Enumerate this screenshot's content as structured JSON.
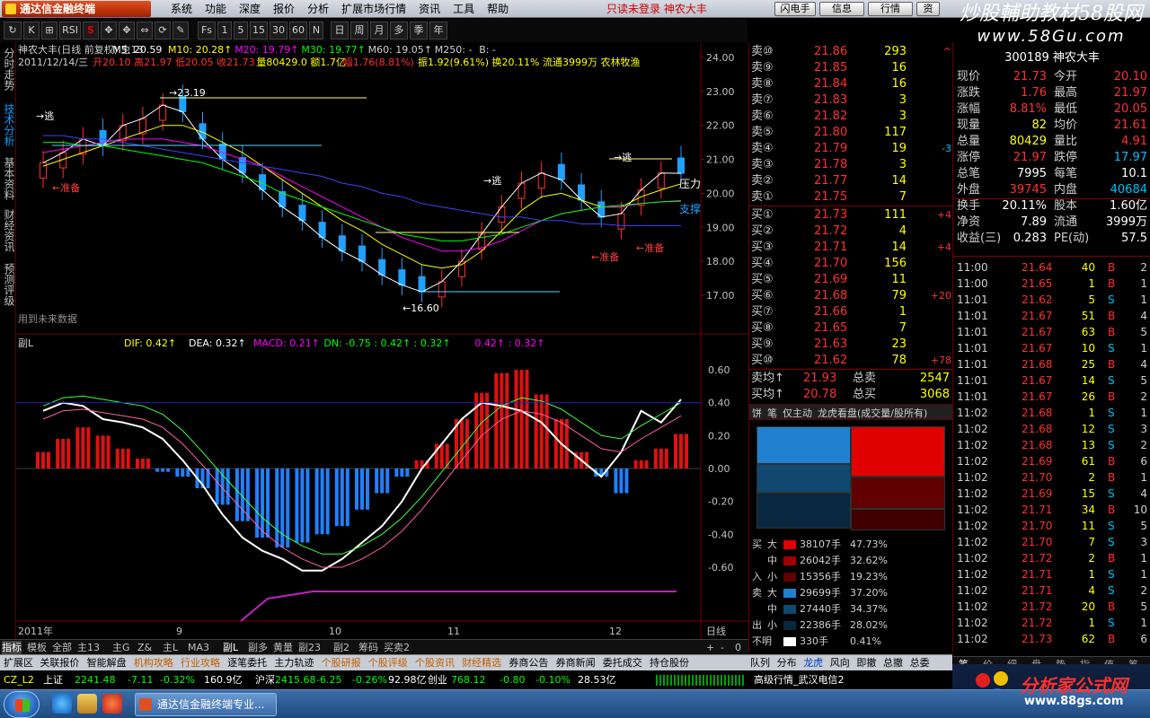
{
  "app": {
    "logo_text": "通达信金融终端",
    "menu": [
      "系统",
      "功能",
      "深度",
      "报价",
      "分析",
      "扩展市场行情",
      "资讯",
      "工具",
      "帮助"
    ],
    "promo": "只读未登录  神农大丰",
    "top_buttons": [
      "闪电手",
      "信息",
      "行情",
      "资"
    ],
    "watermark_title": "炒股輔助教材58股网",
    "watermark_url": "www.58Gu.com"
  },
  "toolbar": {
    "buttons": [
      "↻",
      "K",
      "⊞",
      "RSI",
      "S",
      "✥",
      "✥",
      "⇔",
      "⟳",
      "✎",
      "Fs",
      "1",
      "5",
      "15",
      "30",
      "60",
      "N",
      "日",
      "周",
      "月",
      "多",
      "季",
      "年"
    ]
  },
  "left_tabs": [
    {
      "label": "分时走势",
      "active": false
    },
    {
      "label": "技术分析",
      "active": true
    },
    {
      "label": "基本资料",
      "active": false
    },
    {
      "label": "财经资讯",
      "active": false
    },
    {
      "label": "预测评级",
      "active": false
    }
  ],
  "main_header": {
    "line1": [
      {
        "text": "神农大丰(日线 前复权) 主13",
        "color": "#d0d0d0"
      },
      {
        "text": "M5: 20.59",
        "color": "#ffffff"
      },
      {
        "text": "M10: 20.28↑",
        "color": "#ffff00"
      },
      {
        "text": "M20: 19.79↑",
        "color": "#ff00ff"
      },
      {
        "text": "M30: 19.77↑",
        "color": "#00ff00"
      },
      {
        "text": "M60: 19.05↑",
        "color": "#d0d0d0"
      },
      {
        "text": "M250: -",
        "color": "#d0d0d0"
      },
      {
        "text": "B: -",
        "color": "#d0d0d0"
      }
    ],
    "line2": [
      {
        "text": "2011/12/14/三",
        "color": "#d0d0d0"
      },
      {
        "text": "开20.10 高21.97 低20.05 收21.73",
        "color": "#ff3030"
      },
      {
        "text": "量80429.0 额1.7亿",
        "color": "#ffff00"
      },
      {
        "text": "幅1.76(8.81%)",
        "color": "#ff3030"
      },
      {
        "text": "振1.92(9.61%) 换20.11% 流通3999万 农林牧渔",
        "color": "#ffff00"
      }
    ],
    "price_axis": [
      "24.00",
      "23.00",
      "22.00",
      "21.00",
      "20.00",
      "19.00",
      "18.00",
      "17.00"
    ],
    "annotations": {
      "high_label": "23.19",
      "low_label": "16.60",
      "pressure": "压力",
      "support": "支撑",
      "escape": "逃",
      "prepare": "准备",
      "footnote": "用到未来数据"
    }
  },
  "sub_header": {
    "title": "副L",
    "items": [
      {
        "text": "DIF: 0.42↑",
        "color": "#ffff00"
      },
      {
        "text": "DEA: 0.32↑",
        "color": "#ffffff"
      },
      {
        "text": "MACD: 0.21↑",
        "color": "#ff00ff"
      },
      {
        "text": "DN: -0.75 : 0.42↑ : 0.32↑",
        "color": "#00ff00"
      },
      {
        "text": "0.42↑ : 0.32↑",
        "color": "#ff00ff"
      }
    ],
    "value_axis": [
      "0.60",
      "0.40",
      "0.20",
      "0.00",
      "-0.20",
      "-0.40",
      "-0.60"
    ]
  },
  "chart_data": {
    "type": "line",
    "title": "神农大丰(日线 前复权)",
    "xlabel": "",
    "ylabel": "",
    "x_ticks": [
      "2011年",
      "9",
      "10",
      "11",
      "12"
    ],
    "ylim": [
      16.4,
      24.3
    ],
    "series": [
      {
        "name": "M5",
        "values": [
          20.9,
          21.2,
          21.6,
          21.4,
          22.0,
          22.2,
          22.6,
          22.4,
          21.6,
          21.0,
          20.6,
          20.1,
          19.6,
          19.2,
          18.7,
          18.3,
          18.0,
          17.6,
          17.3,
          17.1,
          17.4,
          18.0,
          18.8,
          19.6,
          20.3,
          20.6,
          20.4,
          19.8,
          19.3,
          19.4,
          20.1,
          20.6,
          20.59
        ]
      },
      {
        "name": "M10",
        "values": [
          20.8,
          21.0,
          21.2,
          21.4,
          21.6,
          21.8,
          22.0,
          22.0,
          21.8,
          21.5,
          21.2,
          20.8,
          20.4,
          20.0,
          19.6,
          19.2,
          18.9,
          18.5,
          18.2,
          17.9,
          17.8,
          17.9,
          18.3,
          18.9,
          19.5,
          19.9,
          20.0,
          19.8,
          19.6,
          19.6,
          19.9,
          20.1,
          20.28
        ]
      },
      {
        "name": "M20",
        "values": [
          21.2,
          21.3,
          21.4,
          21.5,
          21.6,
          21.6,
          21.6,
          21.5,
          21.4,
          21.2,
          21.0,
          20.8,
          20.5,
          20.2,
          19.9,
          19.6,
          19.3,
          19.0,
          18.7,
          18.5,
          18.3,
          18.3,
          18.4,
          18.6,
          18.9,
          19.2,
          19.4,
          19.5,
          19.6,
          19.6,
          19.7,
          19.75,
          19.79
        ]
      },
      {
        "name": "M30",
        "values": [
          21.5,
          21.5,
          21.4,
          21.4,
          21.3,
          21.2,
          21.1,
          21.0,
          20.9,
          20.7,
          20.5,
          20.3,
          20.0,
          19.8,
          19.6,
          19.4,
          19.2,
          19.0,
          18.8,
          18.7,
          18.6,
          18.6,
          18.7,
          18.8,
          19.0,
          19.2,
          19.4,
          19.5,
          19.6,
          19.65,
          19.7,
          19.75,
          19.77
        ]
      },
      {
        "name": "M60",
        "values": [
          21.7,
          21.7,
          21.6,
          21.6,
          21.5,
          21.4,
          21.3,
          21.2,
          21.1,
          21.0,
          20.9,
          20.8,
          20.7,
          20.6,
          20.5,
          20.3,
          20.2,
          20.0,
          19.9,
          19.7,
          19.6,
          19.5,
          19.4,
          19.3,
          19.3,
          19.2,
          19.2,
          19.1,
          19.1,
          19.05,
          19.05,
          19.05,
          19.05
        ]
      }
    ],
    "macd_bars": [
      0.1,
      0.18,
      0.25,
      0.2,
      0.12,
      0.06,
      -0.02,
      -0.05,
      -0.12,
      -0.22,
      -0.32,
      -0.42,
      -0.48,
      -0.45,
      -0.4,
      -0.35,
      -0.25,
      -0.15,
      -0.05,
      0.05,
      0.15,
      0.3,
      0.46,
      0.58,
      0.6,
      0.45,
      0.3,
      0.1,
      -0.05,
      -0.15,
      0.05,
      0.12,
      0.21
    ],
    "dif": [
      0.35,
      0.4,
      0.38,
      0.3,
      0.28,
      0.25,
      0.18,
      0.05,
      -0.1,
      -0.28,
      -0.42,
      -0.5,
      -0.55,
      -0.62,
      -0.62,
      -0.55,
      -0.45,
      -0.35,
      -0.2,
      0.0,
      0.15,
      0.3,
      0.4,
      0.38,
      0.35,
      0.28,
      0.15,
      0.05,
      -0.05,
      0.1,
      0.35,
      0.28,
      0.42
    ],
    "dea": [
      0.3,
      0.35,
      0.36,
      0.34,
      0.32,
      0.3,
      0.25,
      0.15,
      0.02,
      -0.12,
      -0.25,
      -0.38,
      -0.48,
      -0.55,
      -0.6,
      -0.6,
      -0.55,
      -0.48,
      -0.38,
      -0.25,
      -0.1,
      0.05,
      0.2,
      0.3,
      0.35,
      0.33,
      0.28,
      0.2,
      0.12,
      0.1,
      0.18,
      0.25,
      0.32
    ]
  },
  "order_book": {
    "sell": [
      {
        "label": "卖⑩",
        "price": "21.86",
        "vol": "293",
        "extra": "^"
      },
      {
        "label": "卖⑨",
        "price": "21.85",
        "vol": "16",
        "extra": ""
      },
      {
        "label": "卖⑧",
        "price": "21.84",
        "vol": "16",
        "extra": ""
      },
      {
        "label": "卖⑦",
        "price": "21.83",
        "vol": "3",
        "extra": ""
      },
      {
        "label": "卖⑥",
        "price": "21.82",
        "vol": "3",
        "extra": ""
      },
      {
        "label": "卖⑤",
        "price": "21.80",
        "vol": "117",
        "extra": ""
      },
      {
        "label": "卖④",
        "price": "21.79",
        "vol": "19",
        "extra": "-3"
      },
      {
        "label": "卖③",
        "price": "21.78",
        "vol": "3",
        "extra": ""
      },
      {
        "label": "卖②",
        "price": "21.77",
        "vol": "14",
        "extra": ""
      },
      {
        "label": "卖①",
        "price": "21.75",
        "vol": "7",
        "extra": ""
      }
    ],
    "buy": [
      {
        "label": "买①",
        "price": "21.73",
        "vol": "111",
        "extra": "+4"
      },
      {
        "label": "买②",
        "price": "21.72",
        "vol": "4",
        "extra": ""
      },
      {
        "label": "买③",
        "price": "21.71",
        "vol": "14",
        "extra": "+4"
      },
      {
        "label": "买④",
        "price": "21.70",
        "vol": "156",
        "extra": ""
      },
      {
        "label": "买⑤",
        "price": "21.69",
        "vol": "11",
        "extra": ""
      },
      {
        "label": "买⑥",
        "price": "21.68",
        "vol": "79",
        "extra": "+20"
      },
      {
        "label": "买⑦",
        "price": "21.66",
        "vol": "1",
        "extra": ""
      },
      {
        "label": "买⑧",
        "price": "21.65",
        "vol": "7",
        "extra": ""
      },
      {
        "label": "买⑨",
        "price": "21.63",
        "vol": "23",
        "extra": ""
      },
      {
        "label": "买⑩",
        "price": "21.62",
        "vol": "78",
        "extra": "+78"
      }
    ],
    "avg": [
      {
        "label": "卖均↑",
        "price": "21.93",
        "tlabel": "总卖",
        "tval": "2547"
      },
      {
        "label": "买均↑",
        "price": "20.78",
        "tlabel": "总买",
        "tval": "3068"
      }
    ],
    "tabs": [
      "饼",
      "笔",
      "仅主动",
      "龙虎看盘(成交量/股所有)"
    ],
    "flow": [
      {
        "side": "买",
        "size": "大",
        "color": "#e00000",
        "vol": "38107手",
        "pct": "47.73%"
      },
      {
        "side": "",
        "size": "中",
        "color": "#a00000",
        "vol": "26042手",
        "pct": "32.62%"
      },
      {
        "side": "入",
        "size": "小",
        "color": "#600000",
        "vol": "15356手",
        "pct": "19.23%"
      },
      {
        "side": "卖",
        "size": "大",
        "color": "#2080d0",
        "vol": "29699手",
        "pct": "37.20%"
      },
      {
        "side": "",
        "size": "中",
        "color": "#104870",
        "vol": "27440手",
        "pct": "34.37%"
      },
      {
        "side": "出",
        "size": "小",
        "color": "#082840",
        "vol": "22386手",
        "pct": "28.02%"
      },
      {
        "side": "不明",
        "size": "",
        "color": "#ffffff",
        "vol": "330手",
        "pct": "0.41%"
      }
    ]
  },
  "quote": {
    "code_name": "300189 神农大丰",
    "rows": [
      {
        "l1": "现价",
        "v1": "21.73",
        "c1": "#ff3030",
        "l2": "今开",
        "v2": "20.10",
        "c2": "#ff3030"
      },
      {
        "l1": "涨跌",
        "v1": "1.76",
        "c1": "#ff3030",
        "l2": "最高",
        "v2": "21.97",
        "c2": "#ff3030"
      },
      {
        "l1": "涨幅",
        "v1": "8.81%",
        "c1": "#ff3030",
        "l2": "最低",
        "v2": "20.05",
        "c2": "#ff3030"
      },
      {
        "l1": "现量",
        "v1": "82",
        "c1": "#ffff00",
        "l2": "均价",
        "v2": "21.61",
        "c2": "#ff3030"
      },
      {
        "l1": "总量",
        "v1": "80429",
        "c1": "#ffff00",
        "l2": "量比",
        "v2": "4.91",
        "c2": "#ff3030"
      },
      {
        "l1": "涨停",
        "v1": "21.97",
        "c1": "#ff3030",
        "l2": "跌停",
        "v2": "17.97",
        "c2": "#00c0ff"
      },
      {
        "l1": "总笔",
        "v1": "7995",
        "c1": "#ffffff",
        "l2": "每笔",
        "v2": "10.1",
        "c2": "#ffffff"
      },
      {
        "l1": "外盘",
        "v1": "39745",
        "c1": "#ff3030",
        "l2": "内盘",
        "v2": "40684",
        "c2": "#00c0ff"
      },
      {
        "l1": "换手",
        "v1": "20.11%",
        "c1": "#ffffff",
        "l2": "股本",
        "v2": "1.60亿",
        "c2": "#ffffff"
      },
      {
        "l1": "净资",
        "v1": "7.89",
        "c1": "#ffffff",
        "l2": "流通",
        "v2": "3999万",
        "c2": "#ffffff"
      },
      {
        "l1": "收益(三)",
        "v1": "0.283",
        "c1": "#ffffff",
        "l2": "PE(动)",
        "v2": "57.5",
        "c2": "#ffffff"
      }
    ],
    "ticks": [
      {
        "t": "11:00",
        "p": "21.64",
        "v": "40",
        "d": "B",
        "n": "2"
      },
      {
        "t": "11:00",
        "p": "21.65",
        "v": "1",
        "d": "B",
        "n": "1"
      },
      {
        "t": "11:01",
        "p": "21.62",
        "v": "5",
        "d": "S",
        "n": "1"
      },
      {
        "t": "11:01",
        "p": "21.67",
        "v": "51",
        "d": "B",
        "n": "4"
      },
      {
        "t": "11:01",
        "p": "21.67",
        "v": "63",
        "d": "B",
        "n": "5"
      },
      {
        "t": "11:01",
        "p": "21.67",
        "v": "10",
        "d": "S",
        "n": "1"
      },
      {
        "t": "11:01",
        "p": "21.68",
        "v": "25",
        "d": "B",
        "n": "4"
      },
      {
        "t": "11:01",
        "p": "21.67",
        "v": "14",
        "d": "S",
        "n": "5"
      },
      {
        "t": "11:01",
        "p": "21.67",
        "v": "26",
        "d": "B",
        "n": "2"
      },
      {
        "t": "11:02",
        "p": "21.68",
        "v": "1",
        "d": "S",
        "n": "1"
      },
      {
        "t": "11:02",
        "p": "21.68",
        "v": "12",
        "d": "S",
        "n": "3"
      },
      {
        "t": "11:02",
        "p": "21.68",
        "v": "13",
        "d": "S",
        "n": "2"
      },
      {
        "t": "11:02",
        "p": "21.69",
        "v": "61",
        "d": "B",
        "n": "6"
      },
      {
        "t": "11:02",
        "p": "21.70",
        "v": "2",
        "d": "B",
        "n": "1"
      },
      {
        "t": "11:02",
        "p": "21.69",
        "v": "15",
        "d": "S",
        "n": "4"
      },
      {
        "t": "11:02",
        "p": "21.71",
        "v": "34",
        "d": "B",
        "n": "10"
      },
      {
        "t": "11:02",
        "p": "21.70",
        "v": "11",
        "d": "S",
        "n": "5"
      },
      {
        "t": "11:02",
        "p": "21.70",
        "v": "7",
        "d": "S",
        "n": "3"
      },
      {
        "t": "11:02",
        "p": "21.72",
        "v": "2",
        "d": "B",
        "n": "1"
      },
      {
        "t": "11:02",
        "p": "21.71",
        "v": "1",
        "d": "S",
        "n": "1"
      },
      {
        "t": "11:02",
        "p": "21.71",
        "v": "4",
        "d": "S",
        "n": "2"
      },
      {
        "t": "11:02",
        "p": "21.72",
        "v": "20",
        "d": "B",
        "n": "5"
      },
      {
        "t": "11:02",
        "p": "21.72",
        "v": "1",
        "d": "S",
        "n": "1"
      },
      {
        "t": "11:02",
        "p": "21.73",
        "v": "62",
        "d": "B",
        "n": "6"
      }
    ],
    "bottom_tabs": [
      "笔",
      "价",
      "细",
      "盘",
      "势",
      "指",
      "值",
      "筹"
    ]
  },
  "bottom_tabs": [
    "指标",
    "模板",
    "全部",
    "主13",
    "主G",
    "Z&",
    "主L",
    "MA3",
    "副L",
    "副多",
    "黄量",
    "副23",
    "副2",
    "筹码",
    "买卖2"
  ],
  "zoom_controls": {
    "label": "日线",
    "plus": "+",
    "minus": "-",
    "zero": "0"
  },
  "bottom_bar": {
    "left": [
      "扩展区",
      "关联报价",
      "智能解盘",
      "机构攻略",
      "行业攻略",
      "逐笔委托",
      "主力轨迹",
      "个股研报",
      "个股评级",
      "个股资讯",
      "财经精选",
      "券商公告",
      "券商新闻",
      "委托成交",
      "持仓股份"
    ],
    "right": [
      "队列",
      "分布",
      "龙虎",
      "风向",
      "即撤",
      "总撤",
      "总委"
    ]
  },
  "status": {
    "items": [
      {
        "text": "CZ_L2",
        "color": "#ffff00"
      },
      {
        "text": "上证",
        "color": "#ffffff"
      },
      {
        "text": "2241.48",
        "color": "#00ff00"
      },
      {
        "text": "-7.11",
        "color": "#00ff00"
      },
      {
        "text": "-0.32%",
        "color": "#00ff00"
      },
      {
        "text": "160.9亿",
        "color": "#ffffff"
      },
      {
        "text": "沪深",
        "color": "#ffffff"
      },
      {
        "text": "2415.68",
        "color": "#00ff00"
      },
      {
        "text": "-6.25",
        "color": "#00ff00"
      },
      {
        "text": "-0.26%",
        "color": "#00ff00"
      },
      {
        "text": "92.98亿",
        "color": "#ffffff"
      },
      {
        "text": "创业",
        "color": "#ffffff"
      },
      {
        "text": "768.12",
        "color": "#00ff00"
      },
      {
        "text": "-0.80",
        "color": "#00ff00"
      },
      {
        "text": "-0.10%",
        "color": "#00ff00"
      },
      {
        "text": "28.53亿",
        "color": "#ffffff"
      },
      {
        "text": "高级行情_武汉电信2",
        "color": "#ffffff"
      }
    ]
  },
  "taskbar": {
    "app_label": "通达信金融终端专业...",
    "fx_text": "分析家公式网",
    "fx_url": "www.88gs.com"
  }
}
